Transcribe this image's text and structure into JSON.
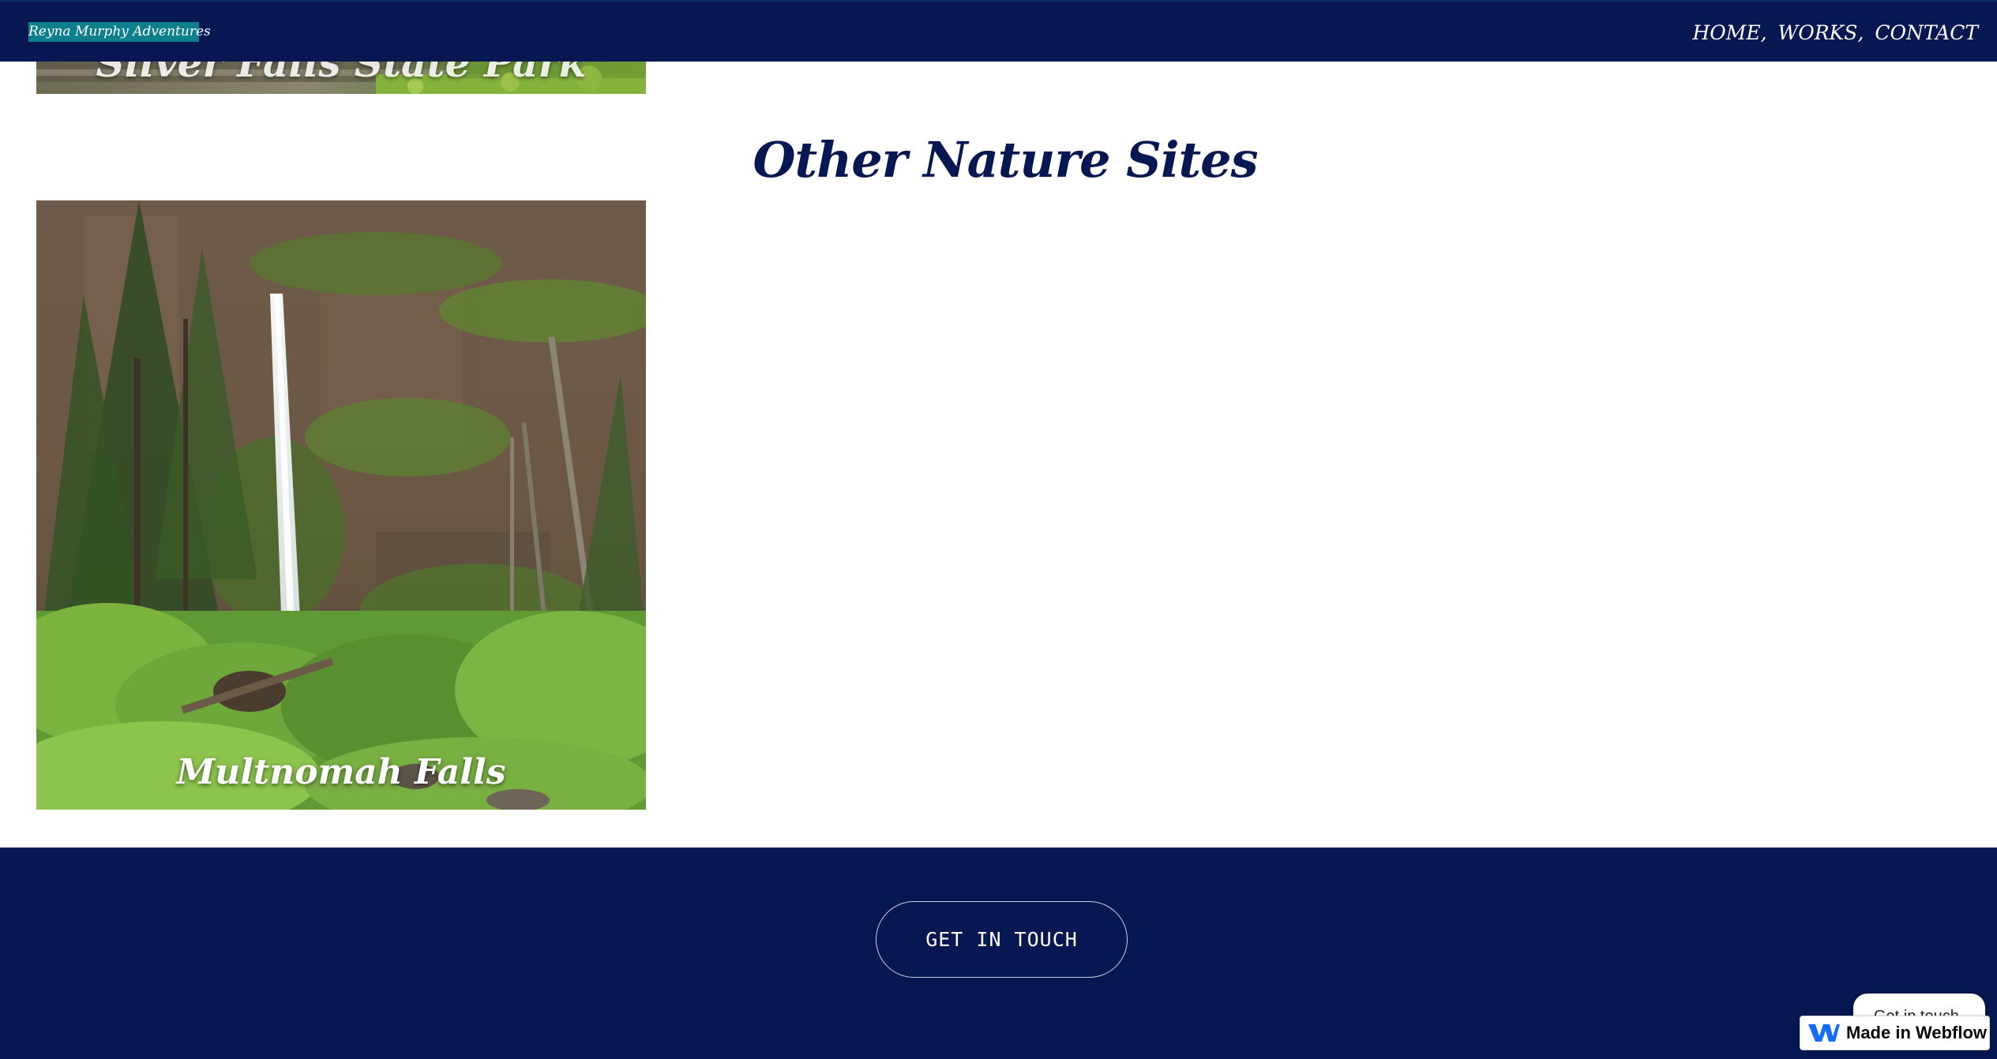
{
  "nav": {
    "brand": "Reyna Murphy Adventures",
    "links": [
      {
        "label": "HOME"
      },
      {
        "label": "WORKS"
      },
      {
        "label": "CONTACT"
      }
    ],
    "separator": ","
  },
  "gallery_top": {
    "caption": "Silver Falls State Park"
  },
  "section": {
    "title": "Other Nature Sites"
  },
  "gallery_main": {
    "caption": "Multnomah Falls"
  },
  "footer": {
    "cta_label": "GET IN TOUCH",
    "chat_bubble_text": "Get in touch",
    "badge_label": "Made in Webflow"
  },
  "colors": {
    "navy": "#061751",
    "brand_teal": "#0e7f8c",
    "webflow_blue": "#146ef5"
  }
}
